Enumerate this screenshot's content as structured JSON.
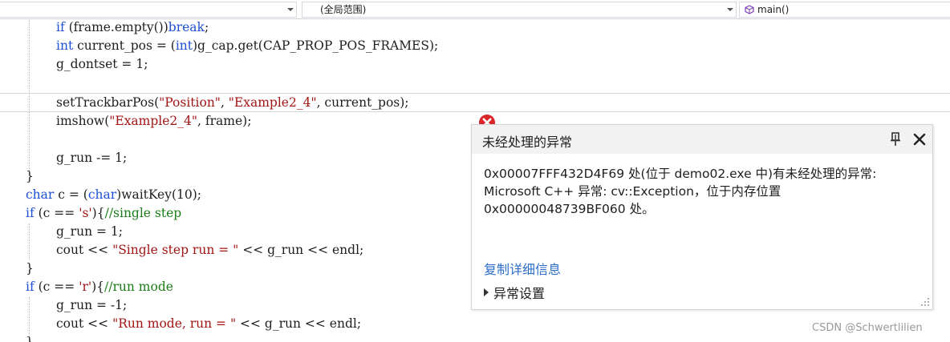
{
  "navbar": {
    "scope_label": "(全局范围)",
    "function_label": "main()"
  },
  "code": {
    "lines": [
      [
        {
          "t": "if",
          "c": "kw"
        },
        {
          "t": " (frame.empty())"
        },
        {
          "t": "break",
          "c": "kw"
        },
        {
          "t": ";"
        }
      ],
      [
        {
          "t": "int",
          "c": "kw"
        },
        {
          "t": " current_pos = ("
        },
        {
          "t": "int",
          "c": "kw"
        },
        {
          "t": ")g_cap.get(CAP_PROP_POS_FRAMES);"
        }
      ],
      [
        {
          "t": "g_dontset = 1;"
        }
      ],
      [],
      [
        {
          "t": "setTrackbarPos("
        },
        {
          "t": "\"Position\"",
          "c": "str"
        },
        {
          "t": ", "
        },
        {
          "t": "\"Example2_4\"",
          "c": "str"
        },
        {
          "t": ", current_pos);"
        }
      ],
      [
        {
          "t": "imshow("
        },
        {
          "t": "\"Example2_4\"",
          "c": "str"
        },
        {
          "t": ", frame);"
        }
      ],
      [],
      [
        {
          "t": "g_run -= 1;"
        }
      ],
      [
        {
          "t": "}"
        }
      ],
      [
        {
          "t": "char",
          "c": "kw"
        },
        {
          "t": " c = ("
        },
        {
          "t": "char",
          "c": "kw"
        },
        {
          "t": ")waitKey(10);"
        }
      ],
      [
        {
          "t": "if",
          "c": "kw"
        },
        {
          "t": " (c == "
        },
        {
          "t": "'s'",
          "c": "str"
        },
        {
          "t": "){"
        },
        {
          "t": "//single step",
          "c": "cmt"
        }
      ],
      [
        {
          "t": "g_run = 1;"
        }
      ],
      [
        {
          "t": "cout << "
        },
        {
          "t": "\"Single step run = \"",
          "c": "str"
        },
        {
          "t": " << g_run << endl;"
        }
      ],
      [
        {
          "t": "}"
        }
      ],
      [
        {
          "t": "if",
          "c": "kw"
        },
        {
          "t": " (c == "
        },
        {
          "t": "'r'",
          "c": "str"
        },
        {
          "t": "){"
        },
        {
          "t": "//run mode",
          "c": "cmt"
        }
      ],
      [
        {
          "t": "g_run = -1;"
        }
      ],
      [
        {
          "t": "cout << "
        },
        {
          "t": "\"Run mode, run = \"",
          "c": "str"
        },
        {
          "t": " << g_run << endl;"
        }
      ],
      [
        {
          "t": "}"
        }
      ]
    ]
  },
  "exception": {
    "title": "未经处理的异常",
    "message_lines": [
      "0x00007FFF432D4F69 处(位于 demo02.exe 中)有未经处理的异常:",
      "Microsoft C++ 异常: cv::Exception，位于内存位置",
      "0x00000048739BF060 处。"
    ],
    "copy_details_label": "复制详细信息",
    "settings_label": "异常设置"
  },
  "watermark": "CSDN @Schwertlilien",
  "colors": {
    "keyword": "#1f4fd6",
    "string": "#a31515",
    "comment": "#1a7d1a",
    "link": "#2d6ec9",
    "error": "#d9262b"
  }
}
